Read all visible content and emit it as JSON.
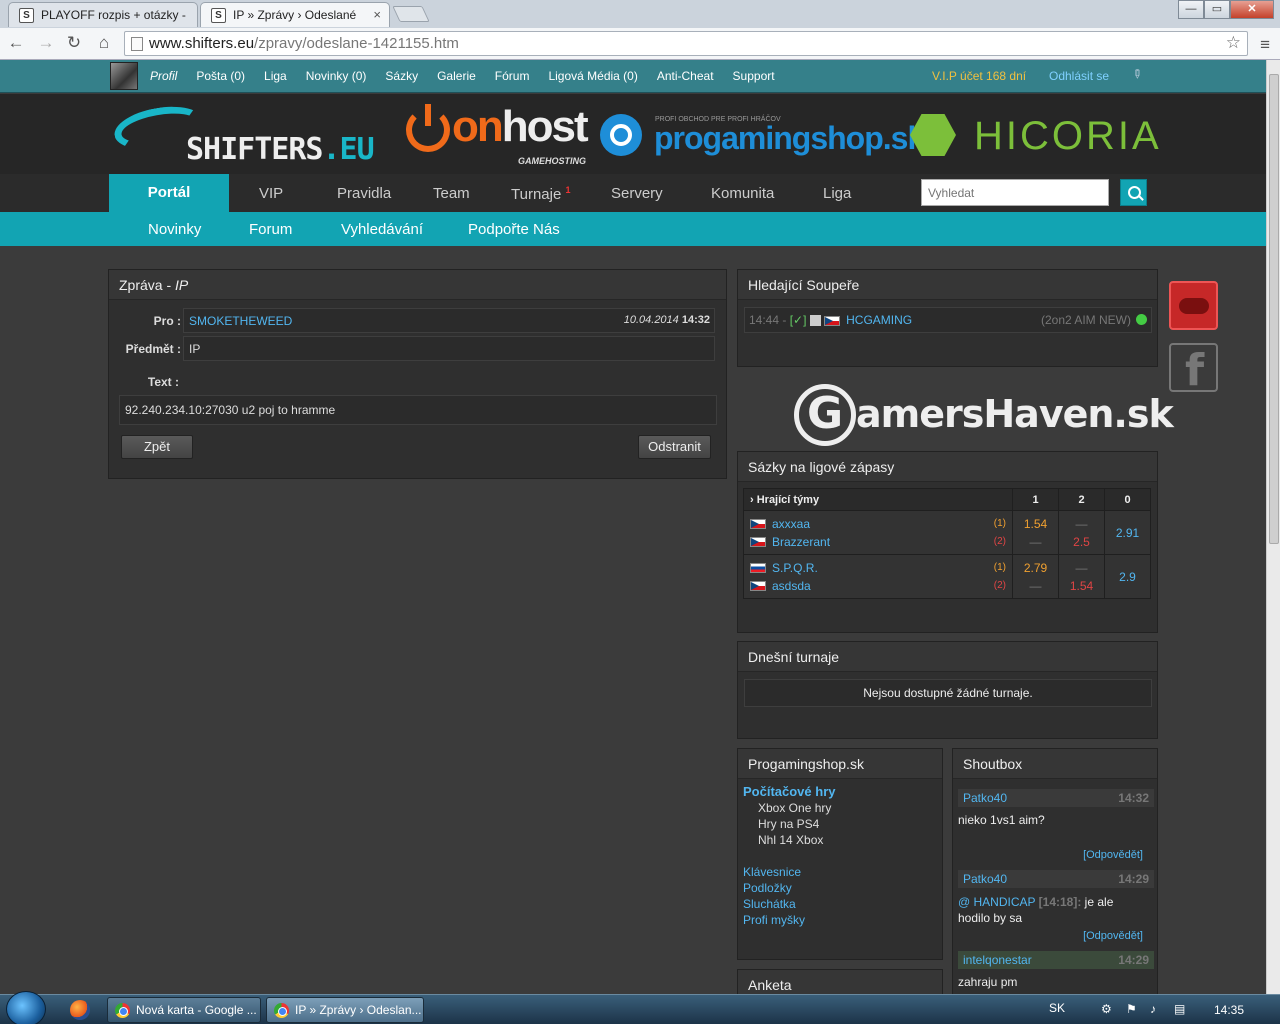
{
  "browser": {
    "tabs": [
      {
        "title": "PLAYOFF rozpis + otázky -",
        "favicon": "S",
        "close": "×"
      },
      {
        "title": "IP » Zprávy › Odeslané",
        "favicon": "S",
        "close": "×"
      }
    ],
    "url_host": "www.shifters.eu",
    "url_path": "/zpravy/odeslane-1421155.htm",
    "window_buttons": {
      "minimize": "—",
      "maximize": "▭",
      "close": "✕"
    }
  },
  "topbar": {
    "items": [
      "Profil",
      "Pošta (0)",
      "Liga",
      "Novinky (0)",
      "Sázky",
      "Galerie",
      "Fórum",
      "Ligová Média (0)",
      "Anti-Cheat",
      "Support"
    ],
    "vip": "V.I.P účet  168 dní",
    "logout": "Odhlásit se"
  },
  "banner": {
    "shifters": {
      "main": "SHIFTERS",
      "suffix": ".EU"
    },
    "onhost": {
      "on": "on",
      "host": "host",
      "sub": "GAMEHOSTING"
    },
    "progamingshop": {
      "tagline": "PROFI OBCHOD PRE PROFI HRÁČOV",
      "word": "progamingshop.sk"
    },
    "hicoria": {
      "hi": "HI",
      "rest": "CORIA"
    }
  },
  "mainnav": {
    "active": "Portál",
    "items": [
      "VIP",
      "Pravidla",
      "Team",
      "Turnaje",
      "Servery",
      "Komunita",
      "Liga"
    ],
    "turnaje_badge": "1",
    "search_placeholder": "Vyhledat"
  },
  "subnav": {
    "items": [
      "Novinky",
      "Forum",
      "Vyhledávání",
      "Podpořte Nás"
    ]
  },
  "message": {
    "title_prefix": "Zpráva - ",
    "title_subject": "IP",
    "to_label": "Pro :",
    "to_value": "SMOKETHEWEED",
    "date": "10.04.2014",
    "time": "14:32",
    "subject_label": "Předmět :",
    "subject_value": "IP",
    "text_label": "Text :",
    "text_value": "92.240.234.10:27030 u2 poj to hramme",
    "back_button": "Zpět",
    "delete_button": "Odstranit"
  },
  "opponents": {
    "title": "Hledající Soupeře",
    "time": "14:44 -",
    "check": "[✓]",
    "team": "HCGAMING",
    "mode": "(2on2 AIM NEW)"
  },
  "gamershaven": {
    "g": "G",
    "rest": "amersHaven.sk"
  },
  "bets": {
    "title": "Sázky na ligové zápasy",
    "headers": [
      "› Hrající týmy",
      "1",
      "2",
      "0"
    ],
    "matches": [
      {
        "team1": "axxxaa",
        "team2": "Brazzerant",
        "tag1": "(1)",
        "tag2": "(2)",
        "odd1": "1.54",
        "odd2": "2.5",
        "odd0": "2.91",
        "dash": "—"
      },
      {
        "team1": "S.P.Q.R.",
        "team2": "asdsda",
        "tag1": "(1)",
        "tag2": "(2)",
        "odd1": "2.79",
        "odd2": "1.54",
        "odd0": "2.9",
        "dash": "—"
      }
    ]
  },
  "tournaments": {
    "title": "Dnešní turnaje",
    "empty": "Nejsou dostupné žádné turnaje."
  },
  "shop": {
    "title": "Progamingshop.sk",
    "category": "Počítačové hry",
    "sub": [
      "Xbox One hry",
      "Hry na PS4",
      "Nhl 14 Xbox"
    ],
    "links": [
      "Klávesnice",
      "Podložky",
      "Sluchátka",
      "Profi myšky"
    ]
  },
  "shoutbox": {
    "title": "Shoutbox",
    "reply": "[Odpovědět]",
    "posts": [
      {
        "user": "Patko40",
        "time": "14:32",
        "text": "nieko 1vs1 aim?"
      },
      {
        "user": "Patko40",
        "time": "14:29",
        "mention_prefix": "@ ",
        "mention": "HANDICAP",
        "mention_time": "[14:18]:",
        "text": " je ale hodilo by sa"
      },
      {
        "user": "intelqonestar",
        "time": "14:29",
        "text": "zahraju pm"
      }
    ]
  },
  "poll": {
    "title": "Anketa"
  },
  "taskbar": {
    "apps": [
      "Nová karta - Google ...",
      "IP » Zprávy › Odeslan..."
    ],
    "lang": "SK",
    "clock": "14:35"
  }
}
